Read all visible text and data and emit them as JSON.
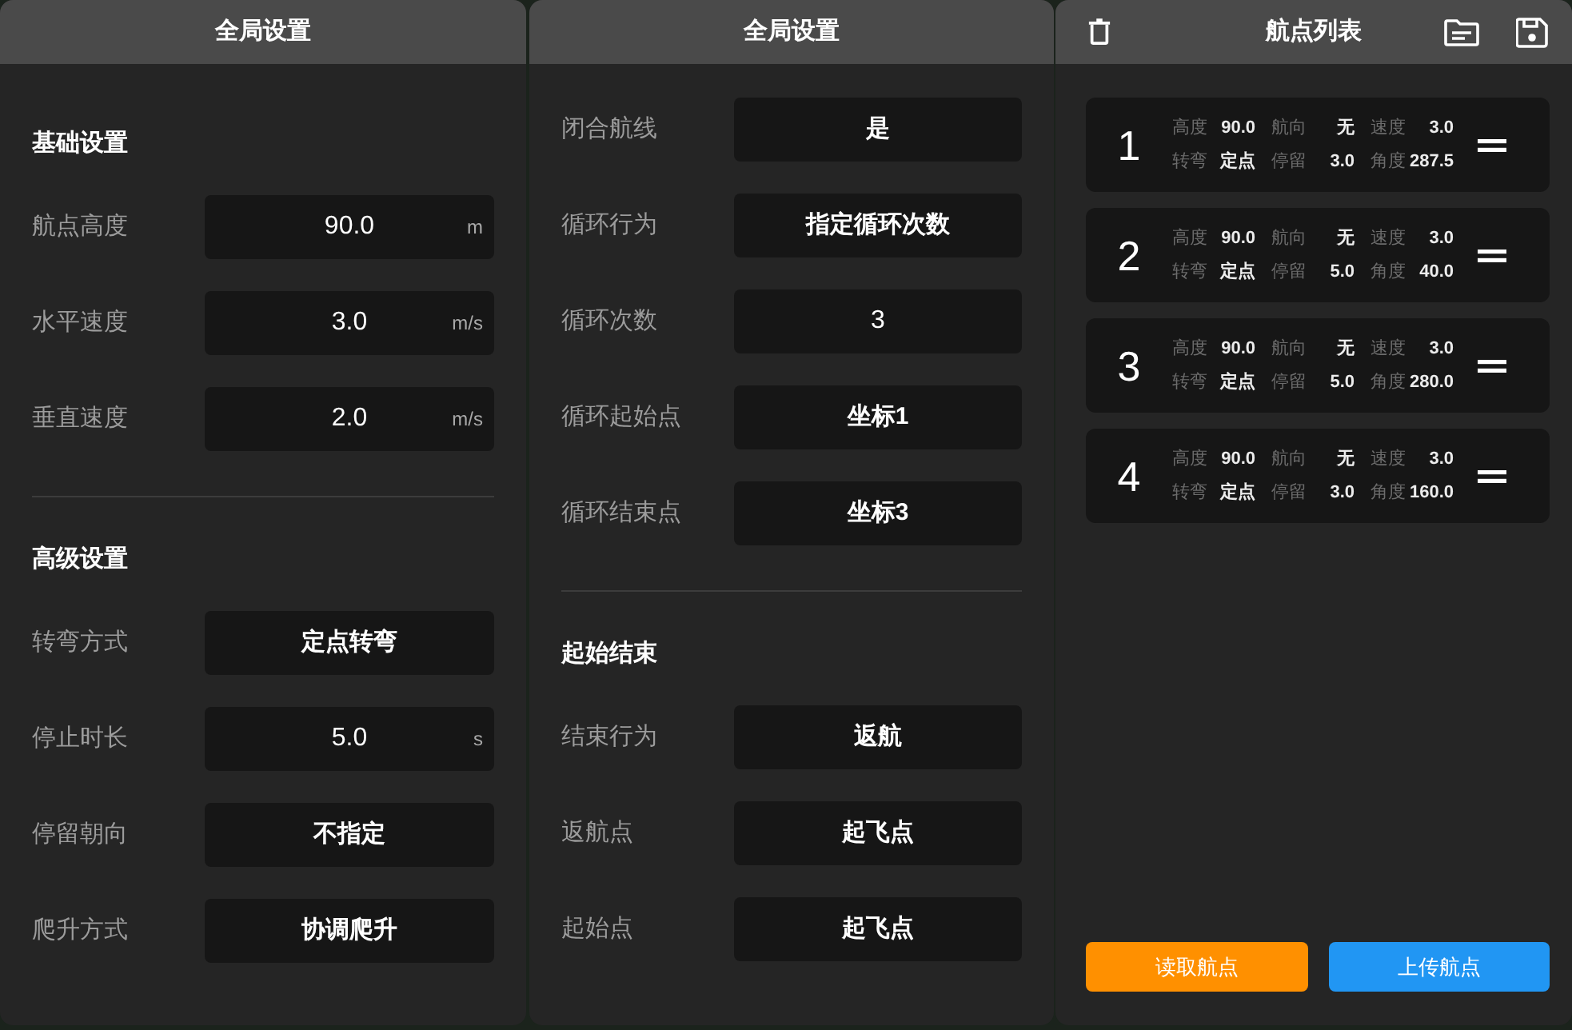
{
  "settings_panels": [
    {
      "title": "全局设置",
      "sections": [
        {
          "title": "基础设置",
          "rows": [
            {
              "kind": "number",
              "label": "航点高度",
              "value": "90.0",
              "unit": "m"
            },
            {
              "kind": "number",
              "label": "水平速度",
              "value": "3.0",
              "unit": "m/s"
            },
            {
              "kind": "number",
              "label": "垂直速度",
              "value": "2.0",
              "unit": "m/s"
            }
          ]
        },
        {
          "title": "高级设置",
          "rows": [
            {
              "kind": "select",
              "label": "转弯方式",
              "value": "定点转弯"
            },
            {
              "kind": "number",
              "label": "停止时长",
              "value": "5.0",
              "unit": "s"
            },
            {
              "kind": "select",
              "label": "停留朝向",
              "value": "不指定"
            },
            {
              "kind": "select",
              "label": "爬升方式",
              "value": "协调爬升"
            }
          ]
        }
      ]
    },
    {
      "title": "全局设置",
      "sections": [
        {
          "rows": [
            {
              "kind": "select",
              "label": "闭合航线",
              "value": "是"
            },
            {
              "kind": "select",
              "label": "循环行为",
              "value": "指定循环次数"
            },
            {
              "kind": "number",
              "label": "循环次数",
              "value": "3"
            },
            {
              "kind": "select",
              "label": "循环起始点",
              "value": "坐标1"
            },
            {
              "kind": "select",
              "label": "循环结束点",
              "value": "坐标3"
            }
          ]
        },
        {
          "title": "起始结束",
          "rows": [
            {
              "kind": "select",
              "label": "结束行为",
              "value": "返航"
            },
            {
              "kind": "select",
              "label": "返航点",
              "value": "起飞点"
            },
            {
              "kind": "select",
              "label": "起始点",
              "value": "起飞点"
            }
          ]
        }
      ]
    }
  ],
  "waypoint_panel": {
    "title": "航点列表",
    "waypoints": [
      {
        "number": "1",
        "fields": [
          {
            "label": "高度",
            "value": "90.0"
          },
          {
            "label": "航向",
            "value": "无"
          },
          {
            "label": "速度",
            "value": "3.0"
          },
          {
            "label": "转弯",
            "value": "定点"
          },
          {
            "label": "停留",
            "value": "3.0"
          },
          {
            "label": "角度",
            "value": "287.5"
          }
        ]
      },
      {
        "number": "2",
        "fields": [
          {
            "label": "高度",
            "value": "90.0"
          },
          {
            "label": "航向",
            "value": "无"
          },
          {
            "label": "速度",
            "value": "3.0"
          },
          {
            "label": "转弯",
            "value": "定点"
          },
          {
            "label": "停留",
            "value": "5.0"
          },
          {
            "label": "角度",
            "value": "40.0"
          }
        ]
      },
      {
        "number": "3",
        "fields": [
          {
            "label": "高度",
            "value": "90.0"
          },
          {
            "label": "航向",
            "value": "无"
          },
          {
            "label": "速度",
            "value": "3.0"
          },
          {
            "label": "转弯",
            "value": "定点"
          },
          {
            "label": "停留",
            "value": "5.0"
          },
          {
            "label": "角度",
            "value": "280.0"
          }
        ]
      },
      {
        "number": "4",
        "fields": [
          {
            "label": "高度",
            "value": "90.0"
          },
          {
            "label": "航向",
            "value": "无"
          },
          {
            "label": "速度",
            "value": "3.0"
          },
          {
            "label": "转弯",
            "value": "定点"
          },
          {
            "label": "停留",
            "value": "3.0"
          },
          {
            "label": "角度",
            "value": "160.0"
          }
        ]
      }
    ],
    "buttons": [
      {
        "label": "读取航点",
        "color": "#ff9000"
      },
      {
        "label": "上传航点",
        "color": "#2196f3"
      }
    ]
  }
}
